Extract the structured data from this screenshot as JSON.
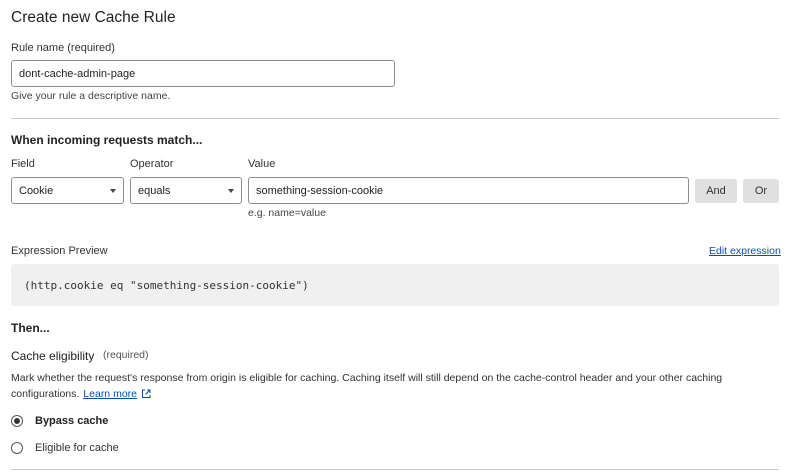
{
  "page_title": "Create new Cache Rule",
  "rule_name": {
    "label": "Rule name (required)",
    "value": "dont-cache-admin-page",
    "help": "Give your rule a descriptive name."
  },
  "match_section": {
    "heading": "When incoming requests match...",
    "field_label": "Field",
    "operator_label": "Operator",
    "value_label": "Value",
    "field_value": "Cookie",
    "operator_value": "equals",
    "value_value": "something-session-cookie",
    "value_hint": "e.g. name=value",
    "and_label": "And",
    "or_label": "Or"
  },
  "expression": {
    "label": "Expression Preview",
    "edit_link": "Edit expression",
    "preview": "(http.cookie eq \"something-session-cookie\")"
  },
  "then_section": {
    "heading": "Then...",
    "eligibility_label": "Cache eligibility",
    "eligibility_required": "(required)",
    "description_line1": "Mark whether the request's response from origin is eligible for caching. Caching itself will still depend on the cache-control header and your other caching",
    "description_line2": "configurations.",
    "learn_more": "Learn more",
    "learn_more_icon": "external-link-icon",
    "options": [
      {
        "label": "Bypass cache",
        "selected": true
      },
      {
        "label": "Eligible for cache",
        "selected": false
      }
    ]
  }
}
